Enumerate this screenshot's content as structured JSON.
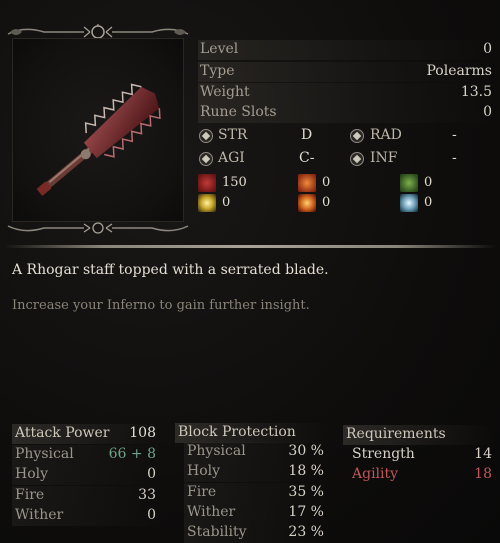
{
  "item": {
    "description": "A Rhogar staff topped with a serrated blade.",
    "insight": "Increase your Inferno to gain further insight."
  },
  "stats": [
    {
      "label": "Level",
      "value": "0"
    },
    {
      "label": "Type",
      "value": "Polearms"
    },
    {
      "label": "Weight",
      "value": "13.5"
    },
    {
      "label": "Rune Slots",
      "value": "0"
    }
  ],
  "scaling": {
    "str": {
      "label": "STR",
      "value": "D",
      "icon": "str-icon"
    },
    "agi": {
      "label": "AGI",
      "value": "C-",
      "icon": "agi-icon"
    },
    "rad": {
      "label": "RAD",
      "value": "-",
      "icon": "rad-icon"
    },
    "inf": {
      "label": "INF",
      "value": "-",
      "icon": "inf-icon"
    }
  },
  "status_effects": [
    {
      "icon": "blood-loss-icon",
      "value": "150",
      "color": "#8a1d1d"
    },
    {
      "icon": "burn-icon",
      "value": "0",
      "color": "#a8421a"
    },
    {
      "icon": "poison-icon",
      "value": "0",
      "color": "#3f6b2a"
    },
    {
      "icon": "lightning-icon",
      "value": "0",
      "color": "#c9a92b"
    },
    {
      "icon": "explosion-icon",
      "value": "0",
      "color": "#c8621c"
    },
    {
      "icon": "frost-icon",
      "value": "0",
      "color": "#6a9db3"
    }
  ],
  "attack_power": {
    "title": "Attack Power",
    "total": "108",
    "rows": [
      {
        "label": "Physical",
        "base": "66",
        "plus": "+",
        "bonus": "8"
      },
      {
        "label": "Holy",
        "value": "0"
      },
      {
        "label": "Fire",
        "value": "33"
      },
      {
        "label": "Wither",
        "value": "0"
      }
    ]
  },
  "block_protection": {
    "title": "Block Protection",
    "rows": [
      {
        "label": "Physical",
        "value": "30 %"
      },
      {
        "label": "Holy",
        "value": "18 %"
      },
      {
        "label": "Fire",
        "value": "35 %"
      },
      {
        "label": "Wither",
        "value": "17 %"
      },
      {
        "label": "Stability",
        "value": "23 %"
      }
    ]
  },
  "requirements": {
    "title": "Requirements",
    "rows": [
      {
        "label": "Strength",
        "value": "14",
        "met": true
      },
      {
        "label": "Agility",
        "value": "18",
        "met": false
      }
    ]
  },
  "colors": {
    "bonus_green": "#6fa48a",
    "unmet_red": "#c2565a"
  }
}
